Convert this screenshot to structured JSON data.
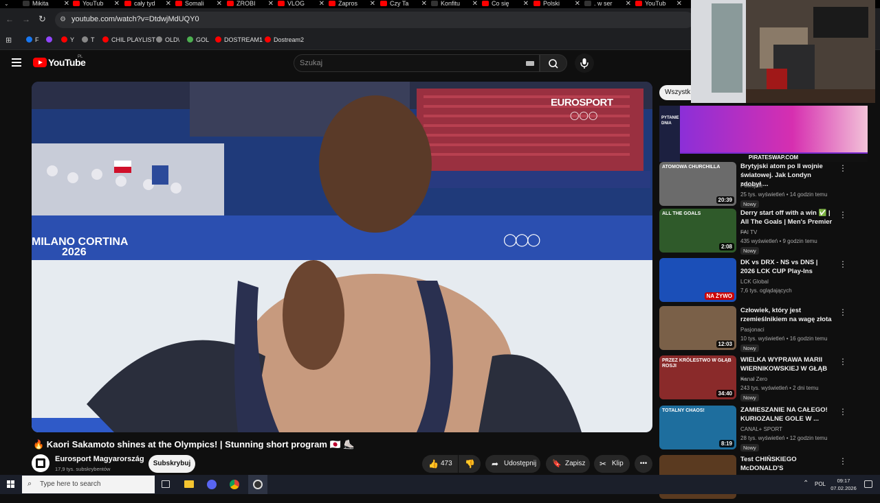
{
  "browser": {
    "tabs": [
      {
        "label": "Mikita",
        "color": "#333333"
      },
      {
        "label": "YouTub",
        "color": "#ff0000"
      },
      {
        "label": "cały tyd",
        "color": "#ff0000"
      },
      {
        "label": "Somali",
        "color": "#ff0000"
      },
      {
        "label": "ZROBI",
        "color": "#ff0000"
      },
      {
        "label": "VLOG",
        "color": "#ff0000"
      },
      {
        "label": "Zapros",
        "color": "#ff0000"
      },
      {
        "label": "Czy Ta",
        "color": "#ff0000"
      },
      {
        "label": "Konfitu",
        "color": "#333333"
      },
      {
        "label": "Co się",
        "color": "#ff0000"
      },
      {
        "label": "Polski",
        "color": "#ff0000"
      },
      {
        "label": ". w ser",
        "color": "#333333"
      },
      {
        "label": "YouTub",
        "color": "#ff0000"
      }
    ],
    "url": "youtube.com/watch?v=DtdwjMdUQY0",
    "bookmarks": [
      {
        "label": "F",
        "color": "#1877f2"
      },
      {
        "label": "",
        "color": "#9146ff"
      },
      {
        "label": "Y",
        "color": "#ff0000"
      },
      {
        "label": "T",
        "color": "#888888"
      },
      {
        "label": "CHIL PLAYLIST",
        "color": "#ff0000"
      },
      {
        "label": "OLD\\",
        "color": "#888888"
      },
      {
        "label": "GOL",
        "color": "#4caf50"
      },
      {
        "label": "DOSTREAM1",
        "color": "#ff0000"
      },
      {
        "label": "Dostream2",
        "color": "#ff0000"
      }
    ]
  },
  "youtube": {
    "logo_text": "YouTube",
    "logo_region": "PL",
    "search_placeholder": "Szukaj",
    "chip_label": "Wszystk"
  },
  "video": {
    "overlay_brand": "EUROSPORT",
    "board_text": "MILANO CORTINA",
    "board_year": "2026",
    "title": "🔥 Kaori Sakamoto shines at the Olympics! | Stunning short program 🇯🇵 ⛸️",
    "channel_name": "Eurosport Magyarország",
    "subscribers": "17,9 tys. subskrybentów",
    "subscribe_label": "Subskrybuj",
    "likes": "473",
    "share_label": "Udostępnij",
    "save_label": "Zapisz",
    "clip_label": "Klip"
  },
  "sidebar": {
    "ad_brand": "PIRATESWAP.COM",
    "ad_lines": [
      "PYTANIE",
      "DNIA"
    ],
    "items": [
      {
        "title": "Brytyjski atom po II wojnie światowej. Jak Londyn zdobył ...",
        "channel": "Powojnie",
        "meta": "25 tys. wyświetleń • 14 godzin temu",
        "badge": "Nowy",
        "duration": "20:39",
        "thumb": "#6b6b6b",
        "thumb_label": "ATOMOWA CHURCHILLA"
      },
      {
        "title": "Derry start off with a win ✅ | All The Goals | Men's Premier ...",
        "channel": "FAI TV",
        "meta": "435 wyświetleń • 9 godzin temu",
        "badge": "Nowy",
        "duration": "2:08",
        "thumb": "#2f5a2a",
        "thumb_label": "ALL THE GOALS"
      },
      {
        "title": "DK vs DRX - NS vs DNS | 2026 LCK CUP Play-Ins",
        "channel": "LCK Global",
        "meta": "7,6 tys. oglądających",
        "badge": "",
        "duration": "NA ŻYWO",
        "thumb": "#1b4fb8",
        "thumb_label": ""
      },
      {
        "title": "Człowiek, który jest rzemieślnikiem na wagę złota",
        "channel": "Pasjonaci",
        "meta": "10 tys. wyświetleń • 16 godzin temu",
        "badge": "Nowy",
        "duration": "12:03",
        "thumb": "#7a6048",
        "thumb_label": ""
      },
      {
        "title": "WIELKA WYPRAWA MARII WIERNIKOWSKIEJ W GŁĄB ...",
        "channel": "Kanał Zero",
        "meta": "243 tys. wyświetleń • 2 dni temu",
        "badge": "Nowy",
        "duration": "34:40",
        "thumb": "#8a2a2a",
        "thumb_label": "PRZEZ KRÓLESTWO W GŁĄB ROSJI"
      },
      {
        "title": "ZAMIESZANIE NA CAŁEGO! KURIOZALNE GOLE W ...",
        "channel": "CANAL+ SPORT",
        "meta": "28 tys. wyświetleń • 12 godzin temu",
        "badge": "Nowy",
        "duration": "8:19",
        "thumb": "#1e6e9e",
        "thumb_label": "TOTALNY CHAOS!"
      },
      {
        "title": "Test CHIŃSKIEGO McDONALD'S",
        "channel": "",
        "meta": "",
        "badge": "",
        "duration": "",
        "thumb": "#5a3a20",
        "thumb_label": ""
      }
    ]
  },
  "taskbar": {
    "search_placeholder": "Type here to search",
    "lang": "POL",
    "time": "09:17",
    "date": "07.02.2026"
  }
}
